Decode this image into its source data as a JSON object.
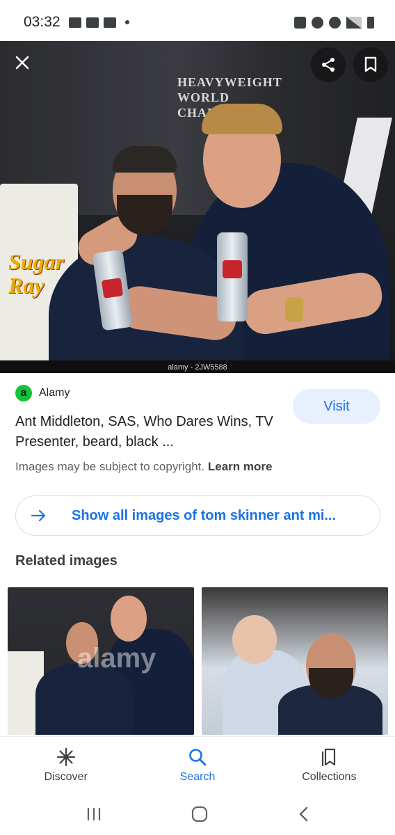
{
  "status_bar": {
    "time": "03:32"
  },
  "image_viewer": {
    "credit": "alamy - 2JW5588",
    "wall_text": "HEAVYWEIGHT WORLD CHAMPION",
    "sign_text": "Sugar Ray"
  },
  "source": {
    "logo_letter": "a",
    "name": "Alamy"
  },
  "result": {
    "title": "Ant Middleton, SAS, Who Dares Wins, TV Presenter, beard, black ...",
    "visit_label": "Visit",
    "copyright_text": "Images may be subject to copyright.",
    "learn_more_label": "Learn more"
  },
  "show_all": {
    "label": "Show all images of tom skinner ant mi..."
  },
  "related": {
    "heading": "Related images",
    "watermark": "alamy"
  },
  "bottom_nav": {
    "items": [
      {
        "label": "Discover",
        "icon": "asterisk-icon",
        "active": false
      },
      {
        "label": "Search",
        "icon": "search-icon",
        "active": true
      },
      {
        "label": "Collections",
        "icon": "collections-icon",
        "active": false
      }
    ]
  },
  "colors": {
    "accent": "#1a73e8",
    "visit_bg": "#e8f0fe",
    "source_logo": "#14c23c"
  }
}
